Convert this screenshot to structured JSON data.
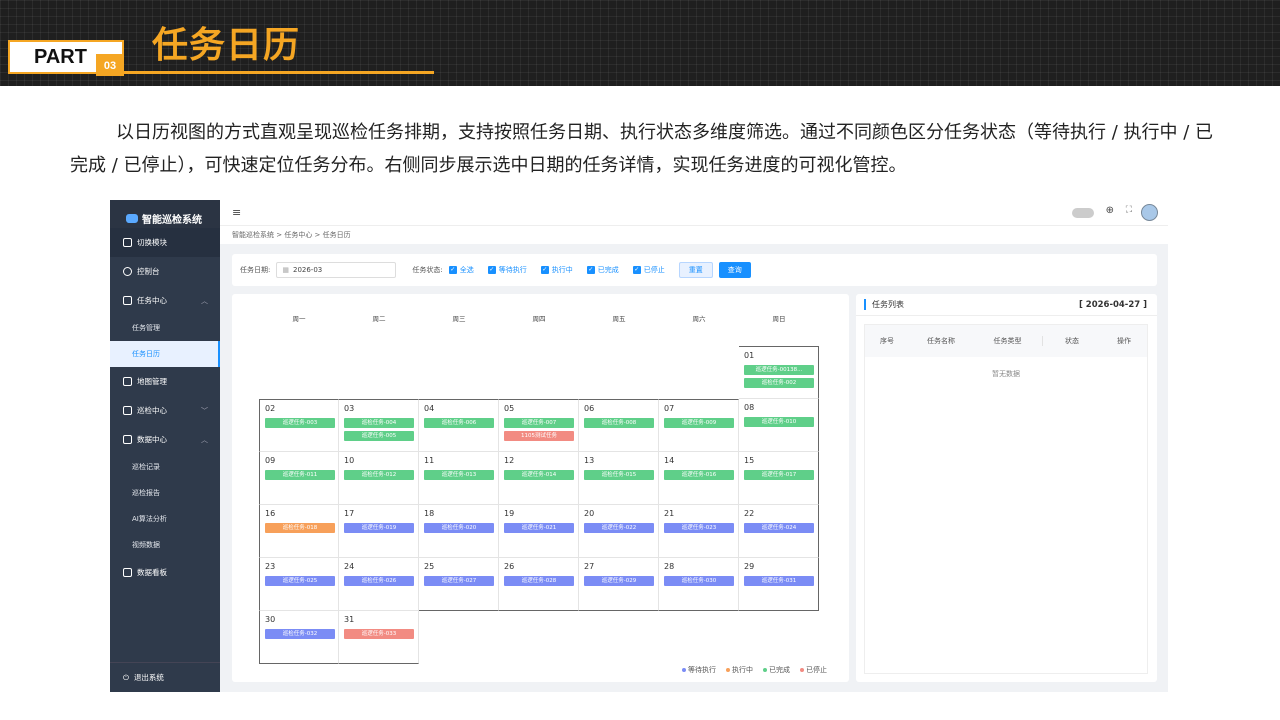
{
  "slide": {
    "part": "PART",
    "part_num": "03",
    "title": "任务日历",
    "description": "以日历视图的方式直观呈现巡检任务排期，支持按照任务日期、执行状态多维度筛选。通过不同颜色区分任务状态（等待执行 / 执行中 / 已完成 / 已停止），可快速定位任务分布。右侧同步展示选中日期的任务详情，实现任务进度的可视化管控。"
  },
  "app": {
    "name": "智能巡检系统",
    "menu": {
      "switch": "切换模块",
      "console": "控制台",
      "task_center": "任务中心",
      "task_manage": "任务管理",
      "task_calendar": "任务日历",
      "map_manage": "地图管理",
      "patrol_center": "巡检中心",
      "data_center": "数据中心",
      "patrol_record": "巡检记录",
      "patrol_report": "巡检报告",
      "ai_analysis": "AI算法分析",
      "video_data": "视频数据",
      "data_board": "数据看板",
      "logout": "退出系统"
    },
    "breadcrumb": [
      "智能巡检系统",
      "任务中心",
      "任务日历"
    ],
    "filter": {
      "date_label": "任务日期:",
      "date_value": "2026-03",
      "status_label": "任务状态:",
      "options": [
        "全选",
        "等待执行",
        "执行中",
        "已完成",
        "已停止"
      ],
      "reset": "重置",
      "query": "查询"
    },
    "weekdays": [
      "周一",
      "周二",
      "周三",
      "周四",
      "周五",
      "周六",
      "周日"
    ],
    "legend": [
      "等待执行",
      "执行中",
      "已完成",
      "已停止"
    ],
    "colors": {
      "waiting": "#7b8cf5",
      "running": "#f7a05a",
      "done": "#5fcf89",
      "stopped": "#f28b82"
    },
    "list": {
      "title": "任务列表",
      "date": "[ 2026-04-27 ]",
      "columns": [
        "序号",
        "任务名称",
        "任务类型",
        "状态",
        "操作"
      ],
      "empty": "暂无数据"
    }
  },
  "calendar": [
    {
      "d": "01",
      "tasks": [
        [
          "巡逻任务-00138...",
          "done"
        ],
        [
          "巡检任务-002",
          "done"
        ]
      ]
    },
    {
      "d": "02",
      "tasks": [
        [
          "巡逻任务-003",
          "done"
        ]
      ]
    },
    {
      "d": "03",
      "tasks": [
        [
          "巡检任务-004",
          "done"
        ],
        [
          "巡逻任务-005",
          "done"
        ]
      ]
    },
    {
      "d": "04",
      "tasks": [
        [
          "巡检任务-006",
          "done"
        ]
      ]
    },
    {
      "d": "05",
      "tasks": [
        [
          "巡逻任务-007",
          "done"
        ],
        [
          "1105测试任务",
          "stopped"
        ]
      ]
    },
    {
      "d": "06",
      "tasks": [
        [
          "巡检任务-008",
          "done"
        ]
      ]
    },
    {
      "d": "07",
      "tasks": [
        [
          "巡逻任务-009",
          "done"
        ]
      ]
    },
    {
      "d": "08",
      "tasks": [
        [
          "巡逻任务-010",
          "done"
        ]
      ]
    },
    {
      "d": "09",
      "tasks": [
        [
          "巡逻任务-011",
          "done"
        ]
      ]
    },
    {
      "d": "10",
      "tasks": [
        [
          "巡检任务-012",
          "done"
        ]
      ]
    },
    {
      "d": "11",
      "tasks": [
        [
          "巡逻任务-013",
          "done"
        ]
      ]
    },
    {
      "d": "12",
      "tasks": [
        [
          "巡逻任务-014",
          "done"
        ]
      ]
    },
    {
      "d": "13",
      "tasks": [
        [
          "巡检任务-015",
          "done"
        ]
      ]
    },
    {
      "d": "14",
      "tasks": [
        [
          "巡逻任务-016",
          "done"
        ]
      ]
    },
    {
      "d": "15",
      "tasks": [
        [
          "巡逻任务-017",
          "done"
        ]
      ]
    },
    {
      "d": "16",
      "tasks": [
        [
          "巡检任务-018",
          "running"
        ]
      ]
    },
    {
      "d": "17",
      "tasks": [
        [
          "巡逻任务-019",
          "waiting"
        ]
      ]
    },
    {
      "d": "18",
      "tasks": [
        [
          "巡检任务-020",
          "waiting"
        ]
      ]
    },
    {
      "d": "19",
      "tasks": [
        [
          "巡逻任务-021",
          "waiting"
        ]
      ]
    },
    {
      "d": "20",
      "tasks": [
        [
          "巡逻任务-022",
          "waiting"
        ]
      ]
    },
    {
      "d": "21",
      "tasks": [
        [
          "巡逻任务-023",
          "waiting"
        ]
      ]
    },
    {
      "d": "22",
      "tasks": [
        [
          "巡逻任务-024",
          "waiting"
        ]
      ]
    },
    {
      "d": "23",
      "tasks": [
        [
          "巡逻任务-025",
          "waiting"
        ]
      ]
    },
    {
      "d": "24",
      "tasks": [
        [
          "巡检任务-026",
          "waiting"
        ]
      ]
    },
    {
      "d": "25",
      "tasks": [
        [
          "巡逻任务-027",
          "waiting"
        ]
      ]
    },
    {
      "d": "26",
      "tasks": [
        [
          "巡逻任务-028",
          "waiting"
        ]
      ]
    },
    {
      "d": "27",
      "tasks": [
        [
          "巡逻任务-029",
          "waiting"
        ]
      ]
    },
    {
      "d": "28",
      "tasks": [
        [
          "巡检任务-030",
          "waiting"
        ]
      ]
    },
    {
      "d": "29",
      "tasks": [
        [
          "巡逻任务-031",
          "waiting"
        ]
      ]
    },
    {
      "d": "30",
      "tasks": [
        [
          "巡检任务-032",
          "waiting"
        ]
      ]
    },
    {
      "d": "31",
      "tasks": [
        [
          "巡逻任务-033",
          "stopped"
        ]
      ]
    }
  ]
}
